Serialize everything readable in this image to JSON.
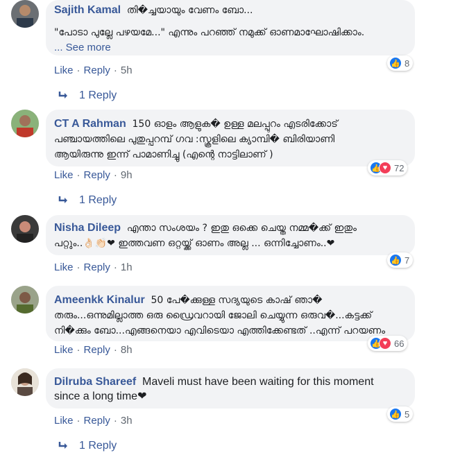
{
  "ui": {
    "like": "Like",
    "reply": "Reply",
    "dot": "·"
  },
  "colors": {
    "link": "#385898",
    "bubble": "#f2f3f5",
    "like_blue": "#1877f2",
    "love_red": "#f33e58",
    "muted": "#606770"
  },
  "comments": [
    {
      "author": "Sajith Kamal",
      "line1": "തി�ച്ചയായും വേണം ബോ...",
      "line2": "\"പോടാ പുല്ലേ പഴയമേ...\" എന്നും പറഞ്ഞ് നമുക്ക് ഓണമാഘോഷിക്കാം.",
      "see_more": "... See more",
      "time": "5h",
      "reactions": "8",
      "reply_text": "1 Reply"
    },
    {
      "author": "CT A Rahman",
      "line1": "150 ഓളം ആളുക� ഉള്ള മലപ്പുറം എടരിക്കോട്",
      "line2": "പഞ്ചായത്തിലെ പുതുപ്പറമ്പ് ഗവ :സ്കൂളിലെ ക്യാമ്പി� ബിരിയാണി",
      "line3": "ആയിരുന്നു ഇന്ന് പാമാണിച്ചു (എന്റെ നാട്ടിലാണ് )",
      "time": "9h",
      "reactions": "72",
      "reply_text": "1 Reply"
    },
    {
      "author": "Nisha Dileep",
      "line1": "എന്താ സംശയം ? ഇതു ഒക്കെ ചെയ്ത നമ്മ�ക്ക് ഇതും",
      "line2": "പറ്റും..👌🏻👏🏻❤ ഇത്തവണ ഒറ്റയ്ക്ക് ഓണം അല്ല ... ഒന്നിച്ചോണം..❤",
      "time": "1h",
      "reactions": "7"
    },
    {
      "author": "Ameenkk Kinalur",
      "line1": "50 പേ�ക്കുള്ള സദ്യയുടെ കാഷ് ഞാ�",
      "line2": "തരും...ഒന്നുമില്ലാത്ത ഒരു ഡ്രൈവറായി ജോലി ചെയ്യുന്ന ഒരുവ�...കട്ടക്ക്",
      "line3": "നി�ക്കും ബോ...എങ്ങനെയാ എവിടെയാ എത്തിക്കേണ്ടത് ..എന്ന് പറയണം",
      "time": "8h",
      "reactions": "66"
    },
    {
      "author": "Dilruba Shareef",
      "line1": "Maveli must have been waiting for this moment",
      "line2": "since a long time❤",
      "time": "3h",
      "reactions": "5",
      "reply_text": "1 Reply"
    }
  ]
}
